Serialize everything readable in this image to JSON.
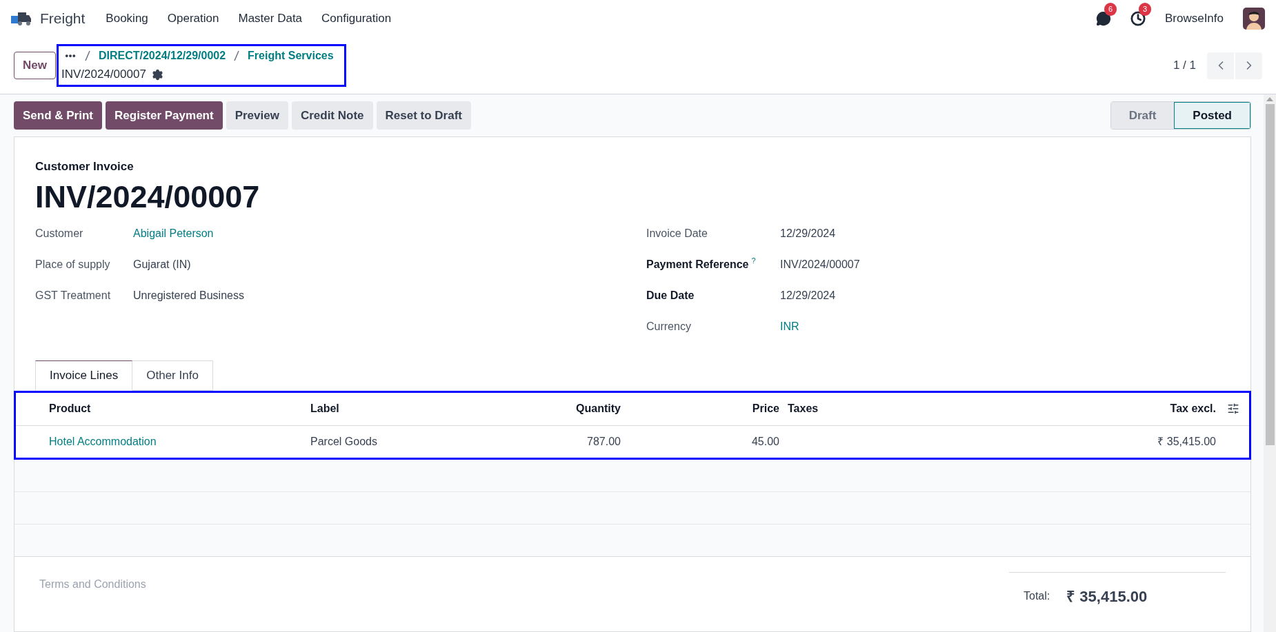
{
  "navbar": {
    "app_name": "Freight",
    "menu": [
      "Booking",
      "Operation",
      "Master Data",
      "Configuration"
    ],
    "messages_count": "6",
    "activities_count": "3",
    "company": "BrowseInfo"
  },
  "control_panel": {
    "new_button": "New",
    "breadcrumb": [
      "DIRECT/2024/12/29/0002",
      "Freight Services"
    ],
    "current": "INV/2024/00007",
    "pager": "1 / 1"
  },
  "action_buttons": [
    {
      "label": "Send & Print",
      "kind": "primary"
    },
    {
      "label": "Register Payment",
      "kind": "primary"
    },
    {
      "label": "Preview",
      "kind": "secondary"
    },
    {
      "label": "Credit Note",
      "kind": "secondary"
    },
    {
      "label": "Reset to Draft",
      "kind": "secondary"
    }
  ],
  "status": [
    {
      "label": "Draft",
      "selected": false
    },
    {
      "label": "Posted",
      "selected": true
    }
  ],
  "form": {
    "subtitle": "Customer Invoice",
    "title": "INV/2024/00007",
    "left_fields": [
      {
        "label": "Customer",
        "value": "Abigail Peterson",
        "kind": "link",
        "required": false
      },
      {
        "label": "Place of supply",
        "value": "Gujarat (IN)",
        "kind": "text",
        "required": false
      },
      {
        "label": "GST Treatment",
        "value": "Unregistered Business",
        "kind": "text",
        "required": false
      }
    ],
    "right_fields": [
      {
        "label": "Invoice Date",
        "value": "12/29/2024",
        "kind": "text",
        "required": false
      },
      {
        "label": "Payment Reference",
        "help": "?",
        "value": "INV/2024/00007",
        "kind": "text",
        "required": true
      },
      {
        "label": "Due Date",
        "value": "12/29/2024",
        "kind": "text",
        "required": true
      },
      {
        "label": "Currency",
        "value": "INR",
        "kind": "link",
        "required": false
      }
    ]
  },
  "tabs": [
    {
      "label": "Invoice Lines",
      "selected": true
    },
    {
      "label": "Other Info",
      "selected": false
    }
  ],
  "table": {
    "columns": [
      "Product",
      "Label",
      "Quantity",
      "Price",
      "Taxes",
      "Tax excl."
    ],
    "rows": [
      {
        "product": "Hotel Accommodation",
        "label": "Parcel Goods",
        "quantity": "787.00",
        "price": "45.00",
        "tax_excl": "₹ 35,415.00"
      }
    ]
  },
  "footer": {
    "terms_placeholder": "Terms and Conditions",
    "total_label": "Total:",
    "total": "₹ 35,415.00"
  }
}
